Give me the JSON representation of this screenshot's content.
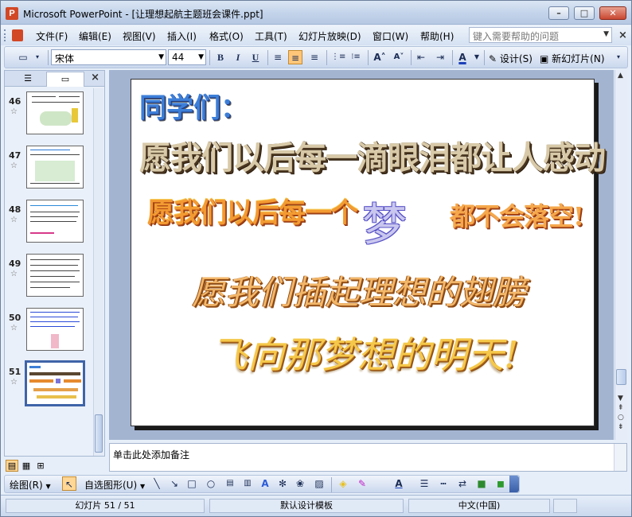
{
  "window": {
    "title": "Microsoft PowerPoint - [让理想起航主题班会课件.ppt]",
    "app_icon": "powerpoint-icon",
    "buttons": [
      "minimize",
      "maximize",
      "close"
    ]
  },
  "menubar": {
    "items": [
      "文件(F)",
      "编辑(E)",
      "视图(V)",
      "插入(I)",
      "格式(O)",
      "工具(T)",
      "幻灯片放映(D)",
      "窗口(W)",
      "帮助(H)"
    ],
    "help_placeholder": "键入需要帮助的问题"
  },
  "toolbar": {
    "font_name": "宋体",
    "font_size": "44",
    "bold": "B",
    "italic": "I",
    "underline": "U",
    "font_color_letter": "A",
    "design_label": "设计(S)",
    "new_slide_label": "新幻灯片(N)",
    "active_alignment": "center"
  },
  "left_pane": {
    "tabs": [
      "outline",
      "slides"
    ],
    "active_tab": "slides",
    "slides": [
      {
        "num": "46"
      },
      {
        "num": "47"
      },
      {
        "num": "48"
      },
      {
        "num": "49"
      },
      {
        "num": "50"
      },
      {
        "num": "51",
        "selected": true
      }
    ]
  },
  "slide": {
    "line1": "同学们：",
    "line2": "愿我们以后每一滴眼泪都让人感动",
    "line3a": "愿我们以后每一个",
    "line3b": "梦",
    "line3c": "都不会落空!",
    "line4": "愿我们插起理想的翅膀",
    "line5": "飞向那梦想的明天!"
  },
  "notes": {
    "placeholder": "单击此处添加备注"
  },
  "drawbar": {
    "draw_label": "绘图(R)",
    "autoshape_label": "自选图形(U)"
  },
  "statusbar": {
    "slide_info": "幻灯片 51 / 51",
    "template": "默认设计模板",
    "language": "中文(中国)"
  }
}
